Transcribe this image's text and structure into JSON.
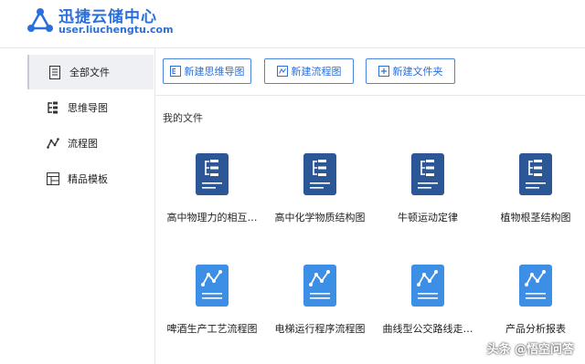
{
  "app": {
    "title": "迅捷云储中心",
    "url": "user.liuchengtu.com",
    "accent": "#2a6fdb",
    "doc_icon_color": "#2b5797",
    "flow_icon_color": "#3d8fe6"
  },
  "sidebar": {
    "items": [
      {
        "label": "全部文件",
        "icon": "document-icon",
        "active": true
      },
      {
        "label": "思维导图",
        "icon": "mindmap-icon",
        "active": false
      },
      {
        "label": "流程图",
        "icon": "flowchart-icon",
        "active": false
      },
      {
        "label": "精品模板",
        "icon": "template-icon",
        "active": false
      }
    ]
  },
  "toolbar": {
    "new_mindmap": "新建思维导图",
    "new_flowchart": "新建流程图",
    "new_folder": "新建文件夹"
  },
  "main": {
    "section_title": "我的文件",
    "files": [
      {
        "name": "高中物理力的相互…",
        "type": "mindmap"
      },
      {
        "name": "高中化学物质结构图",
        "type": "mindmap"
      },
      {
        "name": "牛顿运动定律",
        "type": "mindmap"
      },
      {
        "name": "植物根茎结构图",
        "type": "mindmap"
      },
      {
        "name": "啤酒生产工艺流程图",
        "type": "flowchart"
      },
      {
        "name": "电梯运行程序流程图",
        "type": "flowchart"
      },
      {
        "name": "曲线型公交路线走…",
        "type": "flowchart"
      },
      {
        "name": "产品分析报表",
        "type": "flowchart"
      }
    ]
  },
  "watermark": "头条 @悟空问答"
}
